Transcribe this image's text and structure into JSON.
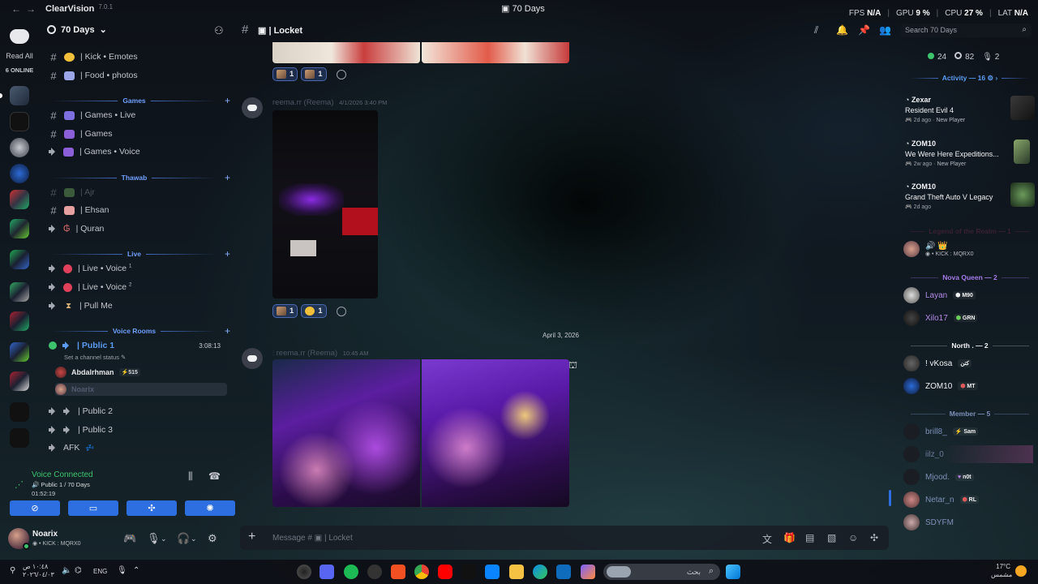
{
  "titlebar": {
    "app_name": "ClearVision",
    "version": "7.0.1",
    "window_title": "70 Days",
    "stats": [
      {
        "label": "FPS",
        "value": "N/A"
      },
      {
        "label": "GPU",
        "value": "9 %"
      },
      {
        "label": "CPU",
        "value": "27 %"
      },
      {
        "label": "LAT",
        "value": "N/A"
      }
    ]
  },
  "rail": {
    "read_all": "Read All",
    "online": "6 ONLINE"
  },
  "server": {
    "name": "70 Days"
  },
  "channels": {
    "kick": "| Kick • Emotes",
    "food": "| Food • photos",
    "cat_games": "Games",
    "games_live": "| Games • Live",
    "games": "| Games",
    "games_voice": "| Games • Voice",
    "cat_thawab": "Thawab",
    "ajr": "| Ajr",
    "ehsan": "| Ehsan",
    "quran": "| Quran",
    "cat_live": "Live",
    "live_voice1": "| Live • Voice",
    "live_voice2": "| Live • Voice",
    "pull_me": "| Pull Me",
    "cat_voice_rooms": "Voice Rooms",
    "public1": "| Public 1",
    "public1_timer": "3:08:13",
    "set_status": "Set a channel status",
    "public2": "| Public 2",
    "public3": "| Public 3",
    "afk": "AFK"
  },
  "voice_users": [
    {
      "name": "Abdalrhman",
      "tag": "515"
    },
    {
      "name": "Noarix"
    }
  ],
  "voice_panel": {
    "status": "Voice Connected",
    "channel": "Public 1 / 70 Days",
    "time": "01:52:19"
  },
  "user": {
    "name": "Noarix",
    "sub": "KICK : MQRX0"
  },
  "chat": {
    "channel_title": "| Locket",
    "search_placeholder": "Search 70 Days",
    "composer_placeholder": "Message #",
    "composer_channel": "| Locket",
    "date_divider": "April 3, 2026",
    "messages": [
      {
        "author": "reema.rr (Reema)",
        "time": "4/1/2026 3:40 PM"
      },
      {
        "author": "reema.rr (Reema)",
        "time": "10:45 AM"
      }
    ],
    "reactions_1": [
      "1",
      "1"
    ],
    "reactions_2": [
      "1",
      "1"
    ]
  },
  "members": {
    "counts": {
      "online": "24",
      "idle": "82",
      "voice": "2"
    },
    "activity_header": "Activity — 16",
    "activities": [
      {
        "user": "Zexar",
        "game": "Resident Evil 4",
        "ago": "2d ago",
        "badge": "New Player"
      },
      {
        "user": "ZOM10",
        "game": "We Were Here Expeditions...",
        "ago": "2w ago",
        "badge": "New Player"
      },
      {
        "user": "ZOM10",
        "game": "Grand Theft Auto V Legacy",
        "ago": "2d ago",
        "badge": ""
      }
    ],
    "legend_header": "Legend of the Realm — 1",
    "legend_member": {
      "name": "",
      "sub": "KICK : MQRX0"
    },
    "nova_header": "Nova Queen — 2",
    "nova": [
      {
        "name": "Layan",
        "tag": "M90"
      },
      {
        "name": "Xilo17",
        "tag": "GRN"
      }
    ],
    "north_header": "North . — 2",
    "north": [
      {
        "name": "! vKosa",
        "tag": "كتن"
      },
      {
        "name": "ZOM10",
        "tag": "MT"
      }
    ],
    "member_header": "Member — 5",
    "member_list": [
      {
        "name": "brill8_",
        "tag": "Sam"
      },
      {
        "name": "iilz_0",
        "tag": ""
      },
      {
        "name": "Mjood.",
        "tag": "n0t"
      },
      {
        "name": "Netar_n",
        "tag": "RL"
      },
      {
        "name": "SDYFM",
        "tag": ""
      }
    ]
  },
  "taskbar": {
    "time": "١٠:٤٨ ص",
    "date": "٢٠٢٦/٠٤/٠٣",
    "lang": "ENG",
    "search_placeholder": "بحث",
    "temp": "17°C",
    "weather": "مشمس"
  },
  "colors": {
    "accent": "#2d6fe0",
    "online": "#3ec46d",
    "link": "#5b9cf2"
  }
}
